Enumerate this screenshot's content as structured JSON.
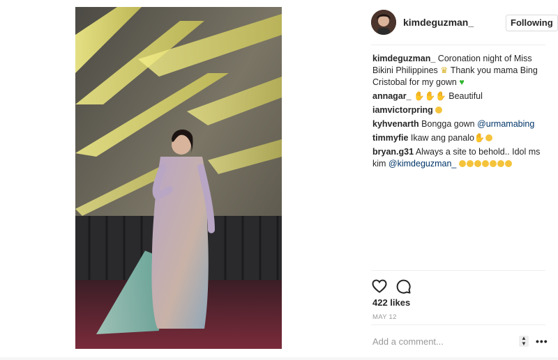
{
  "post": {
    "author": "kimdeguzman_",
    "follow_label": "Following",
    "caption_user": "kimdeguzman_",
    "caption_text": " Coronation night of Miss Bikini Philippines ",
    "caption_text2": " Thank you mama Bing Cristobal for my gown ",
    "comments": [
      {
        "user": "annagar_",
        "text": " Beautiful"
      },
      {
        "user": "iamvictorpring",
        "text": ""
      },
      {
        "user": "kyhvenarth",
        "text": " Bongga gown ",
        "mention": "@urmamabing"
      },
      {
        "user": "timmyfie",
        "text": " Ikaw ang panalo"
      },
      {
        "user": "bryan.g31",
        "text": " Always a site to behold.. Idol ms kim ",
        "mention": "@kimdeguzman_"
      }
    ],
    "likes": "422 likes",
    "date": "MAY 12",
    "comment_placeholder": "Add a comment...",
    "more_label": "•••"
  },
  "colors": {
    "mention": "#003569",
    "border": "#dbdbdb",
    "muted": "#999999"
  },
  "icons": [
    "heart-icon",
    "comment-icon",
    "more-icon"
  ]
}
